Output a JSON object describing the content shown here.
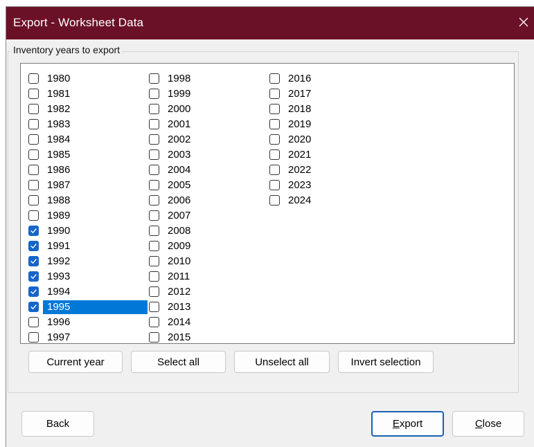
{
  "window": {
    "title": "Export - Worksheet Data",
    "close_glyph": "×"
  },
  "group": {
    "legend": "Inventory years to export"
  },
  "years": {
    "col1": [
      {
        "label": "1980",
        "checked": false,
        "selected": false
      },
      {
        "label": "1981",
        "checked": false,
        "selected": false
      },
      {
        "label": "1982",
        "checked": false,
        "selected": false
      },
      {
        "label": "1983",
        "checked": false,
        "selected": false
      },
      {
        "label": "1984",
        "checked": false,
        "selected": false
      },
      {
        "label": "1985",
        "checked": false,
        "selected": false
      },
      {
        "label": "1986",
        "checked": false,
        "selected": false
      },
      {
        "label": "1987",
        "checked": false,
        "selected": false
      },
      {
        "label": "1988",
        "checked": false,
        "selected": false
      },
      {
        "label": "1989",
        "checked": false,
        "selected": false
      },
      {
        "label": "1990",
        "checked": true,
        "selected": false
      },
      {
        "label": "1991",
        "checked": true,
        "selected": false
      },
      {
        "label": "1992",
        "checked": true,
        "selected": false
      },
      {
        "label": "1993",
        "checked": true,
        "selected": false
      },
      {
        "label": "1994",
        "checked": true,
        "selected": false
      },
      {
        "label": "1995",
        "checked": true,
        "selected": true
      },
      {
        "label": "1996",
        "checked": false,
        "selected": false
      },
      {
        "label": "1997",
        "checked": false,
        "selected": false
      }
    ],
    "col2": [
      {
        "label": "1998",
        "checked": false,
        "selected": false
      },
      {
        "label": "1999",
        "checked": false,
        "selected": false
      },
      {
        "label": "2000",
        "checked": false,
        "selected": false
      },
      {
        "label": "2001",
        "checked": false,
        "selected": false
      },
      {
        "label": "2002",
        "checked": false,
        "selected": false
      },
      {
        "label": "2003",
        "checked": false,
        "selected": false
      },
      {
        "label": "2004",
        "checked": false,
        "selected": false
      },
      {
        "label": "2005",
        "checked": false,
        "selected": false
      },
      {
        "label": "2006",
        "checked": false,
        "selected": false
      },
      {
        "label": "2007",
        "checked": false,
        "selected": false
      },
      {
        "label": "2008",
        "checked": false,
        "selected": false
      },
      {
        "label": "2009",
        "checked": false,
        "selected": false
      },
      {
        "label": "2010",
        "checked": false,
        "selected": false
      },
      {
        "label": "2011",
        "checked": false,
        "selected": false
      },
      {
        "label": "2012",
        "checked": false,
        "selected": false
      },
      {
        "label": "2013",
        "checked": false,
        "selected": false
      },
      {
        "label": "2014",
        "checked": false,
        "selected": false
      },
      {
        "label": "2015",
        "checked": false,
        "selected": false
      }
    ],
    "col3": [
      {
        "label": "2016",
        "checked": false,
        "selected": false
      },
      {
        "label": "2017",
        "checked": false,
        "selected": false
      },
      {
        "label": "2018",
        "checked": false,
        "selected": false
      },
      {
        "label": "2019",
        "checked": false,
        "selected": false
      },
      {
        "label": "2020",
        "checked": false,
        "selected": false
      },
      {
        "label": "2021",
        "checked": false,
        "selected": false
      },
      {
        "label": "2022",
        "checked": false,
        "selected": false
      },
      {
        "label": "2023",
        "checked": false,
        "selected": false
      },
      {
        "label": "2024",
        "checked": false,
        "selected": false
      }
    ]
  },
  "buttons": {
    "current_year": "Current year",
    "select_all": "Select all",
    "unselect_all": "Unselect all",
    "invert_selection": "Invert selection",
    "back": "Back",
    "export_mnemonic": "E",
    "export_rest": "xport",
    "close_mnemonic": "C",
    "close_rest": "lose"
  },
  "colors": {
    "titlebar": "#6b1127",
    "check_accent": "#1565c9",
    "selection": "#0078d7",
    "default_button_border": "#1a5fb4"
  }
}
